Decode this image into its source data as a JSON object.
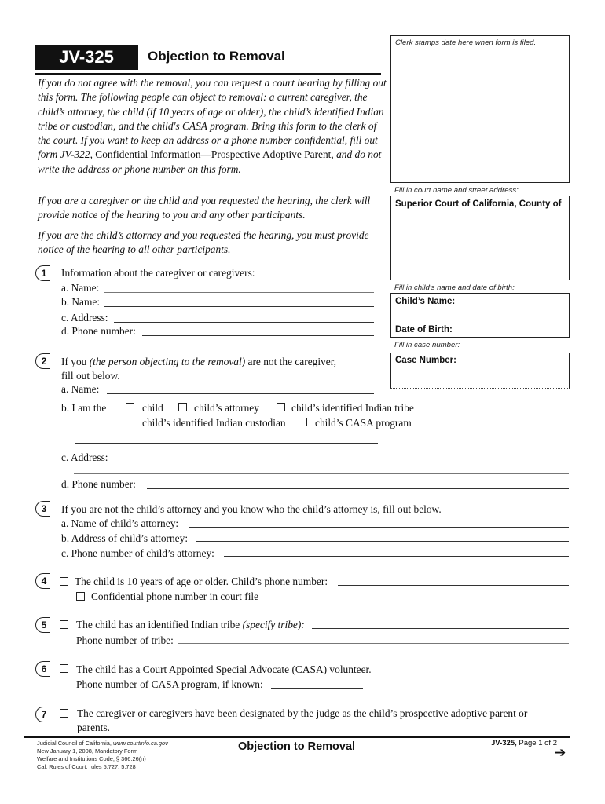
{
  "header": {
    "form_id": "JV-325",
    "title": "Objection to Removal"
  },
  "intro": {
    "p1_a": "If you do not agree with the removal, you can request a court hearing by filling out this form. The following people can object to removal: a current caregiver, the child’s attorney, the child (if 10 years of age or older), the child’s identified Indian tribe or custodian, and the child's CASA program. Bring this form to the clerk of the court. If you want to keep an address or a phone number confidential, fill out form JV-322,",
    "p1_b": " Confidential Information—Prospective Adoptive Parent,",
    "p1_c": " and do not write the address or phone number on this form.",
    "p2": "If you are a caregiver or the child and you requested the hearing, the clerk will provide notice of the hearing to you and any other participants.",
    "p3": "If you are the child’s attorney and you requested the hearing, you must provide notice of the hearing to all other participants."
  },
  "right_column": {
    "clerk_stamp": "Clerk stamps date here when form is filed.",
    "court_hint": "Fill in court name and street address:",
    "court_label": "Superior Court of California, County of",
    "child_hint": "Fill in child's name and date of birth:",
    "child_name_label": "Child’s Name:",
    "dob_label": "Date of Birth:",
    "case_hint": "Fill in case number:",
    "case_label": "Case Number:"
  },
  "section1": {
    "number": "1",
    "heading": "Information about the caregiver or caregivers:",
    "a": "a.  Name:",
    "b": "b.  Name:",
    "c": "c.  Address:",
    "d": "d.  Phone number:",
    "values": {
      "a": "",
      "b": "",
      "c": "",
      "d": ""
    }
  },
  "section2": {
    "number": "2",
    "heading_a": "If you ",
    "heading_b": "(the person objecting to the removal)",
    "heading_c": " are not the caregiver,",
    "heading_2": "fill out below.",
    "a": "a.  Name:",
    "b": "b.  I am the",
    "options": [
      {
        "label": "child",
        "checked": false
      },
      {
        "label": "child’s attorney",
        "checked": false
      },
      {
        "label": "child’s identified Indian tribe",
        "checked": false
      },
      {
        "label": "child’s identified Indian custodian",
        "checked": false
      },
      {
        "label": "child’s CASA program",
        "checked": false
      }
    ],
    "c": "c.  Address:",
    "d": "d.  Phone number:"
  },
  "section3": {
    "number": "3",
    "heading": "If you are not the child’s attorney and you know who the child’s attorney is, fill out below.",
    "a": "a.  Name of child’s attorney:",
    "b": "b.  Address of child’s attorney:",
    "c": "c.  Phone number of child’s attorney:"
  },
  "section4": {
    "number": "4",
    "text": "The child is 10 years of age or older. Child’s phone number:",
    "confidential": "Confidential phone number in court file",
    "checked": false,
    "confidential_checked": false
  },
  "section5": {
    "number": "5",
    "text_a": "The child has an identified Indian tribe ",
    "text_b": "(specify tribe):",
    "phone": "Phone number of tribe:",
    "checked": false
  },
  "section6": {
    "number": "6",
    "text": "The child has a Court Appointed Special Advocate (CASA) volunteer.",
    "phone": "Phone number of CASA program, if known:",
    "checked": false
  },
  "section7": {
    "number": "7",
    "text_1": "The caregiver or caregivers have been designated by the judge as the child’s prospective adoptive parent or",
    "text_2": "parents.",
    "checked": false
  },
  "footer": {
    "line1_a": "Judicial Council of California, ",
    "line1_b": "www.courtinfo.ca.gov",
    "line2": "New January 1, 2008, Mandatory Form",
    "line3": "Welfare and Institutions Code, § 366.26(n)",
    "line4": "Cal. Rules of Court, rules 5.727, 5.728",
    "title": "Objection to Removal",
    "form_id": "JV-325,",
    "page": " Page 1 of 2",
    "arrow_icon": "➔"
  }
}
